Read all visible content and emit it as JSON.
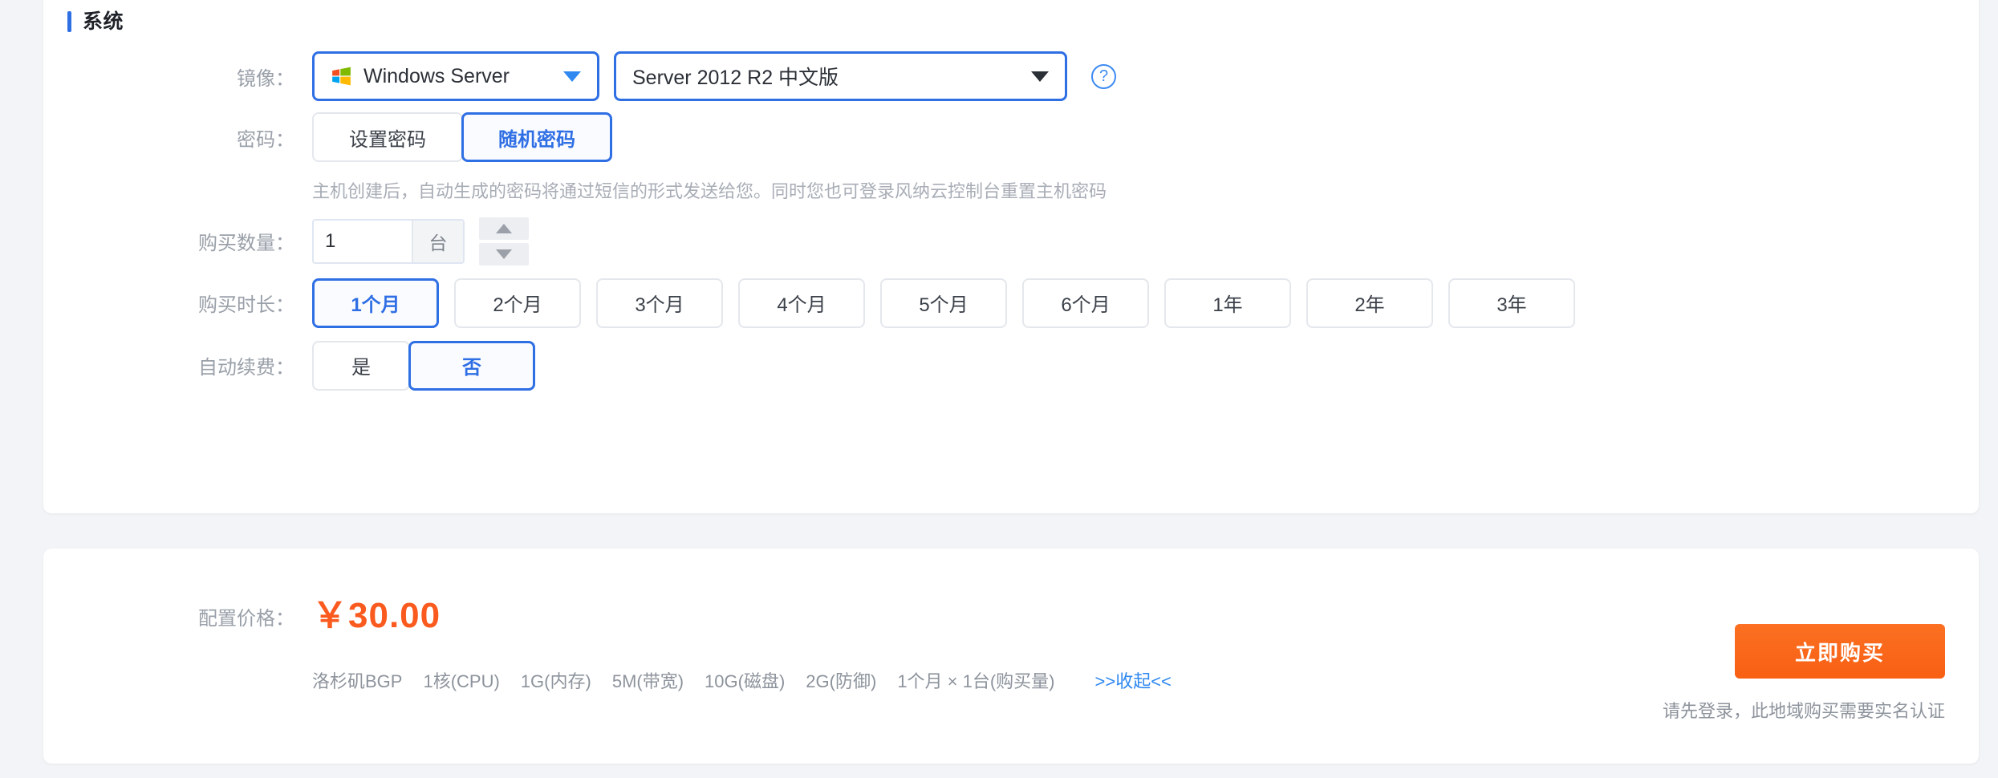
{
  "section": {
    "title": "系统"
  },
  "image_row": {
    "label": "镜像：",
    "os_value": "Windows Server",
    "os_icon": "windows-logo-icon",
    "version_value": "Server 2012 R2 中文版",
    "help_icon": "question-mark-icon"
  },
  "password_row": {
    "label": "密码：",
    "options": [
      {
        "label": "设置密码",
        "selected": false
      },
      {
        "label": "随机密码",
        "selected": true
      }
    ],
    "note": "主机创建后，自动生成的密码将通过短信的形式发送给您。同时您也可登录风纳云控制台重置主机密码"
  },
  "quantity_row": {
    "label": "购买数量：",
    "value": "1",
    "placeholder": "1",
    "unit": "台",
    "increment_icon": "triangle-up-icon",
    "decrement_icon": "triangle-down-icon"
  },
  "duration_row": {
    "label": "购买时长：",
    "options": [
      {
        "label": "1个月",
        "selected": true
      },
      {
        "label": "2个月",
        "selected": false
      },
      {
        "label": "3个月",
        "selected": false
      },
      {
        "label": "4个月",
        "selected": false
      },
      {
        "label": "5个月",
        "selected": false
      },
      {
        "label": "6个月",
        "selected": false
      },
      {
        "label": "1年",
        "selected": false
      },
      {
        "label": "2年",
        "selected": false
      },
      {
        "label": "3年",
        "selected": false
      }
    ]
  },
  "renew_row": {
    "label": "自动续费：",
    "options": [
      {
        "label": "是",
        "selected": false
      },
      {
        "label": "否",
        "selected": true
      }
    ]
  },
  "price_panel": {
    "label": "配置价格：",
    "value": "￥30.00",
    "specs": [
      "洛杉矶BGP",
      "1核(CPU)",
      "1G(内存)",
      "5M(带宽)",
      "10G(磁盘)",
      "2G(防御)",
      "1个月 × 1台(购买量)"
    ],
    "collapse_label": ">>收起<<",
    "buy_label": "立即购买",
    "login_note": "请先登录，此地域购买需要实名认证"
  },
  "colors": {
    "accent_blue": "#2f6fe4",
    "price_orange": "#fa5a1e",
    "buy_orange": "#fa6a1e",
    "muted_text": "#9aa0a9"
  }
}
